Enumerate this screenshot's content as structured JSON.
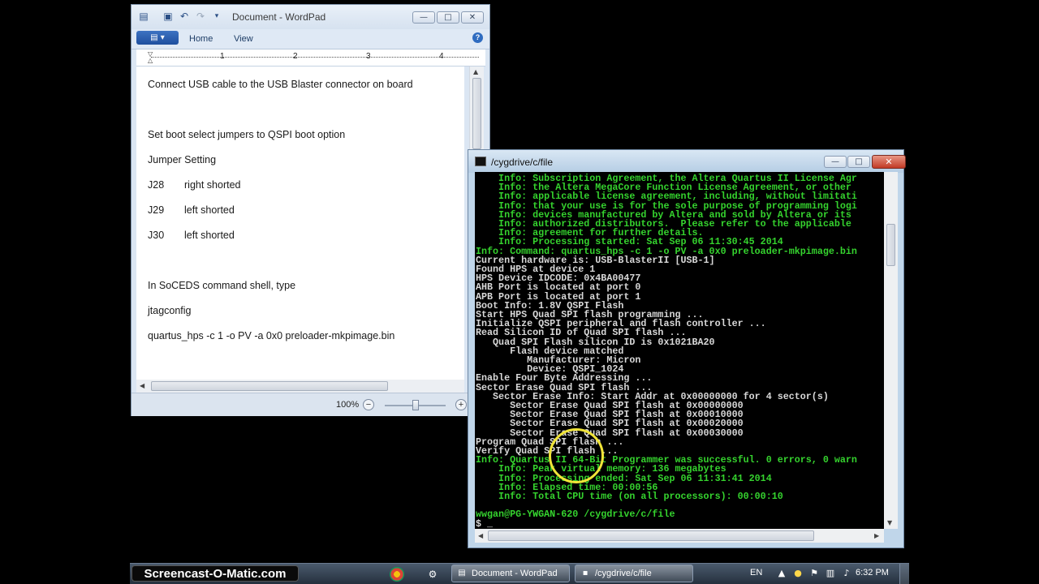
{
  "wordpad": {
    "title": "Document - WordPad",
    "tabs": [
      "Home",
      "View"
    ],
    "ruler_marks": [
      "1",
      "2",
      "3",
      "4"
    ],
    "lines": [
      {
        "text": "Connect USB cable to the USB Blaster connector on board"
      },
      {
        "text": "Set boot select jumpers to QSPI boot option"
      },
      {
        "text": "Jumper Setting"
      },
      {
        "col1": "J28",
        "col2": "right shorted"
      },
      {
        "col1": "J29",
        "col2": "left shorted"
      },
      {
        "col1": "J30",
        "col2": "left shorted"
      },
      {
        "text": "In SoCEDS command shell, type"
      },
      {
        "text": "jtagconfig"
      },
      {
        "text": "quartus_hps -c 1 -o PV -a 0x0 preloader-mkpimage.bin"
      }
    ],
    "zoom": "100%",
    "minimize": "—",
    "maximize": "□",
    "close": "✕",
    "help": "?"
  },
  "terminal": {
    "title": "/cygdrive/c/file",
    "lines": [
      {
        "text": "    Info: Subscription Agreement, the Altera Quartus II License Agr",
        "color": "green"
      },
      {
        "text": "    Info: the Altera MegaCore Function License Agreement, or other",
        "color": "green"
      },
      {
        "text": "    Info: applicable license agreement, including, without limitati",
        "color": "green"
      },
      {
        "text": "    Info: that your use is for the sole purpose of programming logi",
        "color": "green"
      },
      {
        "text": "    Info: devices manufactured by Altera and sold by Altera or its",
        "color": "green"
      },
      {
        "text": "    Info: authorized distributors.  Please refer to the applicable",
        "color": "green"
      },
      {
        "text": "    Info: agreement for further details.",
        "color": "green"
      },
      {
        "text": "    Info: Processing started: Sat Sep 06 11:30:45 2014",
        "color": "green"
      },
      {
        "text": "Info: Command: quartus_hps -c 1 -o PV -a 0x0 preloader-mkpimage.bin",
        "color": "green"
      },
      {
        "text": "Current hardware is: USB-BlasterII [USB-1]",
        "color": "white"
      },
      {
        "text": "Found HPS at device 1",
        "color": "white"
      },
      {
        "text": "HPS Device IDCODE: 0x4BA00477",
        "color": "white"
      },
      {
        "text": "AHB Port is located at port 0",
        "color": "white"
      },
      {
        "text": "APB Port is located at port 1",
        "color": "white"
      },
      {
        "text": "Boot Info: 1.8V QSPI Flash",
        "color": "white"
      },
      {
        "text": "Start HPS Quad SPI flash programming ...",
        "color": "white"
      },
      {
        "text": "Initialize QSPI peripheral and flash controller ...",
        "color": "white"
      },
      {
        "text": "Read Silicon ID of Quad SPI flash ...",
        "color": "white"
      },
      {
        "text": "   Quad SPI Flash silicon ID is 0x1021BA20",
        "color": "white"
      },
      {
        "text": "      Flash device matched",
        "color": "white"
      },
      {
        "text": "         Manufacturer: Micron",
        "color": "white"
      },
      {
        "text": "         Device: QSPI_1024",
        "color": "white"
      },
      {
        "text": "Enable Four Byte Addressing ...",
        "color": "white"
      },
      {
        "text": "Sector Erase Quad SPI flash ...",
        "color": "white"
      },
      {
        "text": "   Sector Erase Info: Start Addr at 0x00000000 for 4 sector(s)",
        "color": "white"
      },
      {
        "text": "      Sector Erase Quad SPI flash at 0x00000000",
        "color": "white"
      },
      {
        "text": "      Sector Erase Quad SPI flash at 0x00010000",
        "color": "white"
      },
      {
        "text": "      Sector Erase Quad SPI flash at 0x00020000",
        "color": "white"
      },
      {
        "text": "      Sector Erase Quad SPI flash at 0x00030000",
        "color": "white"
      },
      {
        "text": "Program Quad SPI flash ...",
        "color": "white"
      },
      {
        "text": "Verify Quad SPI flash ...",
        "color": "white"
      },
      {
        "text": "Info: Quartus II 64-Bit Programmer was successful. 0 errors, 0 warn",
        "color": "green"
      },
      {
        "text": "    Info: Peak virtual memory: 136 megabytes",
        "color": "green"
      },
      {
        "text": "    Info: Processing ended: Sat Sep 06 11:31:41 2014",
        "color": "green"
      },
      {
        "text": "    Info: Elapsed time: 00:00:56",
        "color": "green"
      },
      {
        "text": "    Info: Total CPU time (on all processors): 00:00:10",
        "color": "green"
      },
      {
        "text": "",
        "color": "white"
      },
      {
        "text": "wwgan@PG-YWGAN-620 /cygdrive/c/file",
        "color": "green"
      },
      {
        "text": "$ _",
        "color": "white"
      }
    ]
  },
  "taskbar": {
    "watermark": "Screencast-O-Matic.com",
    "buttons": [
      "Document - WordPad",
      "/cygdrive/c/file"
    ],
    "language": "EN",
    "time": "6:32 PM"
  }
}
